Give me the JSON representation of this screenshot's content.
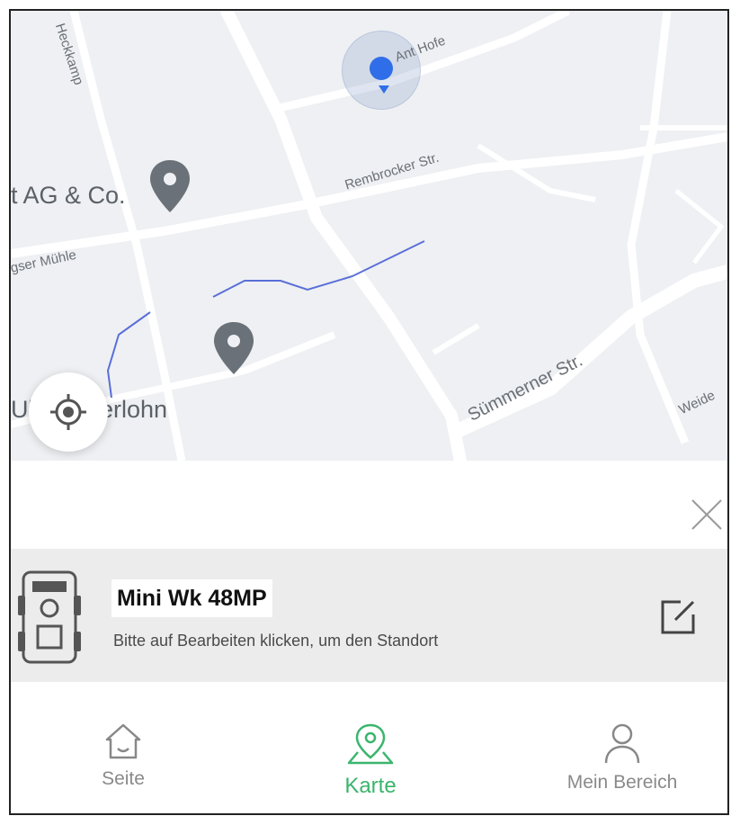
{
  "map": {
    "road_labels": [
      "Ant Hofe",
      "Rembrocker Str.",
      "gser Mühle",
      "Sümmerner Str.",
      "Weide",
      "Heckkamp"
    ],
    "pois": [
      {
        "label": "t AG & Co."
      },
      {
        "label": "Ul    iter Iserlohn"
      }
    ],
    "colors": {
      "background": "#eef0f3",
      "road": "#ffffff",
      "stream": "#5a6fd8",
      "pin": "#6a7178",
      "location": "#2f6ee8"
    }
  },
  "controls": {
    "locate_icon": "crosshair-icon",
    "close_icon": "close-icon"
  },
  "device": {
    "name": "Mini Wk 48MP",
    "hint": "Bitte auf Bearbeiten klicken, um den Standort",
    "icon": "trail-camera-icon",
    "edit_icon": "edit-icon"
  },
  "nav": {
    "items": [
      {
        "label": "Seite",
        "icon": "home-icon"
      },
      {
        "label": "Karte",
        "icon": "map-pin-icon"
      },
      {
        "label": "Mein Bereich",
        "icon": "user-icon"
      }
    ],
    "active": "Karte",
    "active_color": "#3bb56d"
  }
}
